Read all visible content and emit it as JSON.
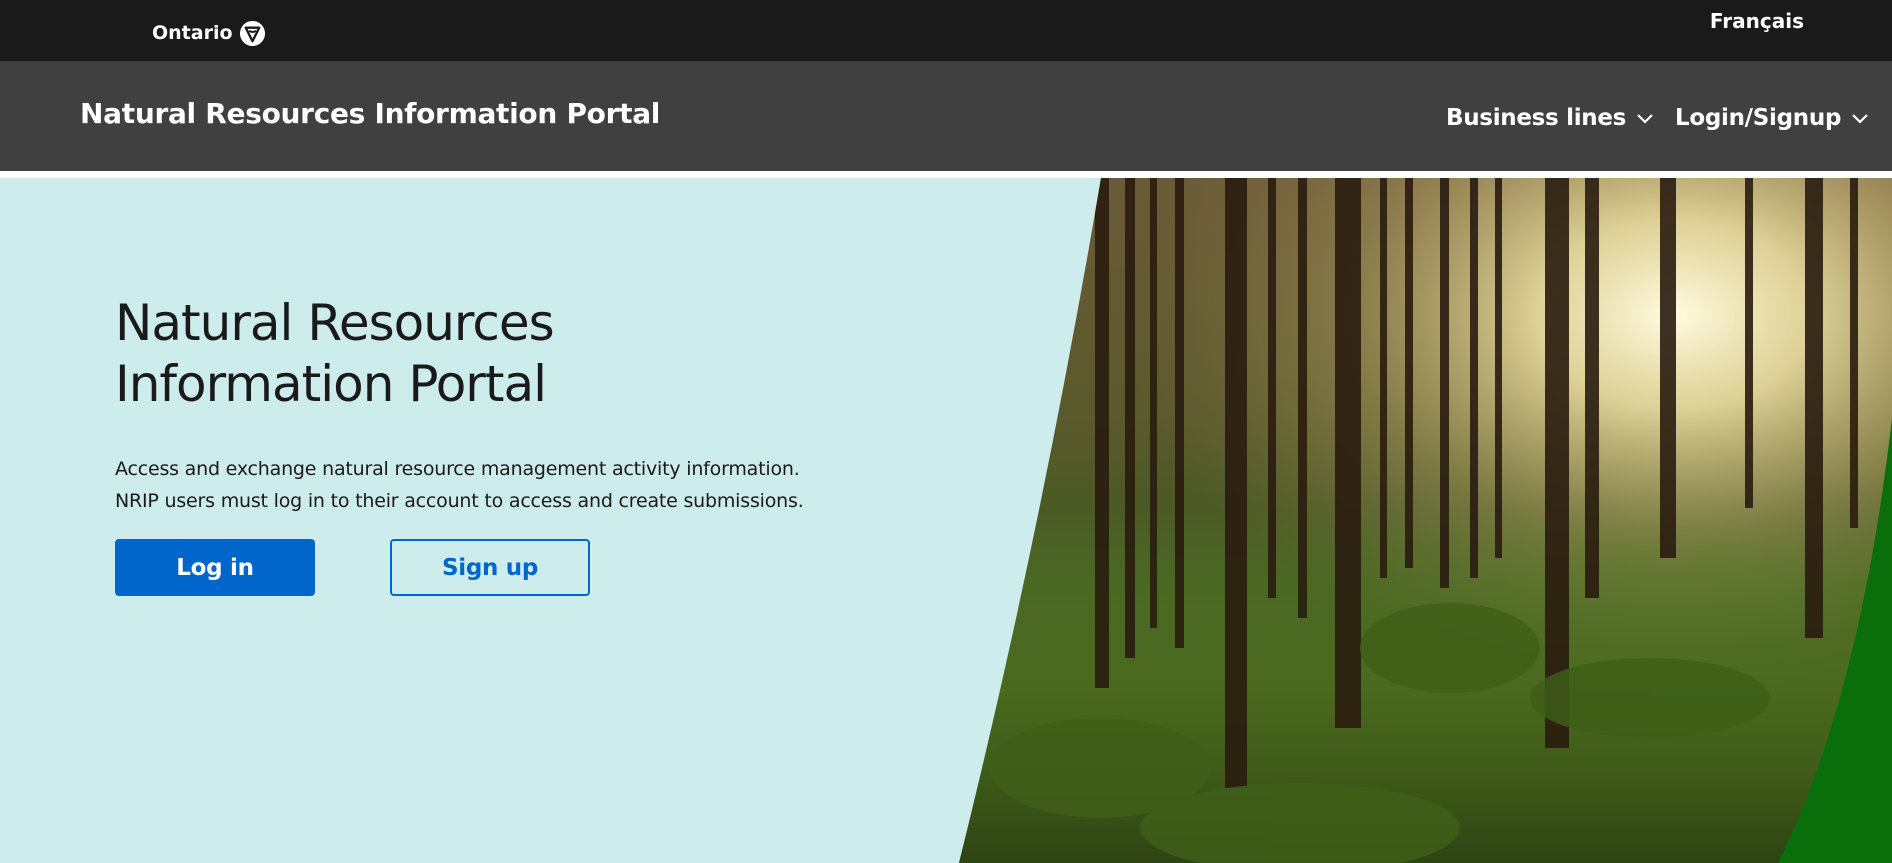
{
  "topbar": {
    "logo_text": "Ontario",
    "logo_icon": "trillium-icon",
    "language_link": "Français"
  },
  "header": {
    "site_title": "Natural Resources Information Portal",
    "nav": [
      {
        "label": "Business lines",
        "icon": "chevron-down-icon"
      },
      {
        "label": "Login/Signup",
        "icon": "chevron-down-icon"
      }
    ]
  },
  "hero": {
    "title_line1": "Natural Resources",
    "title_line2": "Information Portal",
    "text_line1": "Access and exchange natural resource management activity information.",
    "text_line2": "NRIP users must log in to their account to access and create submissions.",
    "login_button": "Log in",
    "signup_button": "Sign up",
    "image": "forest-photo"
  },
  "colors": {
    "topbar": "#1a1a1a",
    "header": "#404040",
    "hero_bg": "#cdecec",
    "primary": "#0066cc",
    "accent_green": "#0a6e0a"
  }
}
